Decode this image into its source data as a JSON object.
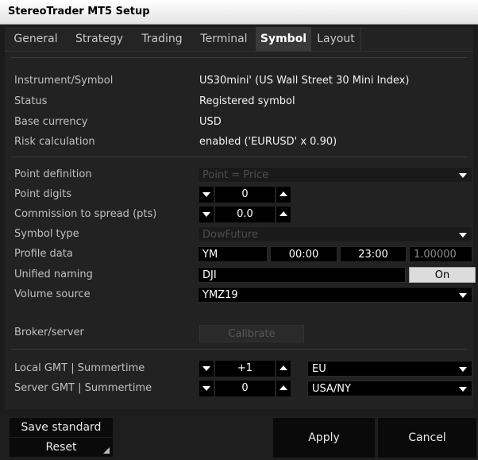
{
  "window": {
    "title": "StereoTrader MT5 Setup"
  },
  "tabs": [
    {
      "label": "General"
    },
    {
      "label": "Strategy"
    },
    {
      "label": "Trading"
    },
    {
      "label": "Terminal"
    },
    {
      "label": "Symbol",
      "active": true
    },
    {
      "label": "Layout"
    }
  ],
  "info": {
    "instrument_label": "Instrument/Symbol",
    "instrument_value": "US30mini' (US Wall Street 30 Mini Index)",
    "status_label": "Status",
    "status_value": "Registered symbol",
    "base_currency_label": "Base currency",
    "base_currency_value": "USD",
    "risk_label": "Risk calculation",
    "risk_value": "enabled ('EURUSD' x 0.90)"
  },
  "settings": {
    "point_definition_label": "Point definition",
    "point_definition_value": "Point = Price",
    "point_digits_label": "Point digits",
    "point_digits_value": "0",
    "commission_label": "Commission to spread (pts)",
    "commission_value": "0.0",
    "symbol_type_label": "Symbol type",
    "symbol_type_value": "DowFuture",
    "profile_label": "Profile data",
    "profile_code": "YM",
    "profile_start": "00:00",
    "profile_end": "23:00",
    "profile_factor": "1.00000",
    "unified_label": "Unified naming",
    "unified_value": "DJI",
    "unified_toggle": "On",
    "volume_label": "Volume source",
    "volume_value": "YMZ19"
  },
  "broker": {
    "label": "Broker/server",
    "calibrate_label": "Calibrate"
  },
  "gmt": {
    "local_label": "Local GMT | Summertime",
    "local_offset": "+1",
    "local_summertime": "EU",
    "server_label": "Server GMT | Summertime",
    "server_offset": "0",
    "server_summertime": "USA/NY"
  },
  "footer": {
    "save_standard": "Save standard",
    "reset": "Reset",
    "apply": "Apply",
    "cancel": "Cancel"
  },
  "colors": {
    "background": "#1c1c1c",
    "field_bg": "#000000",
    "active_tab": "#3a3a3a"
  }
}
